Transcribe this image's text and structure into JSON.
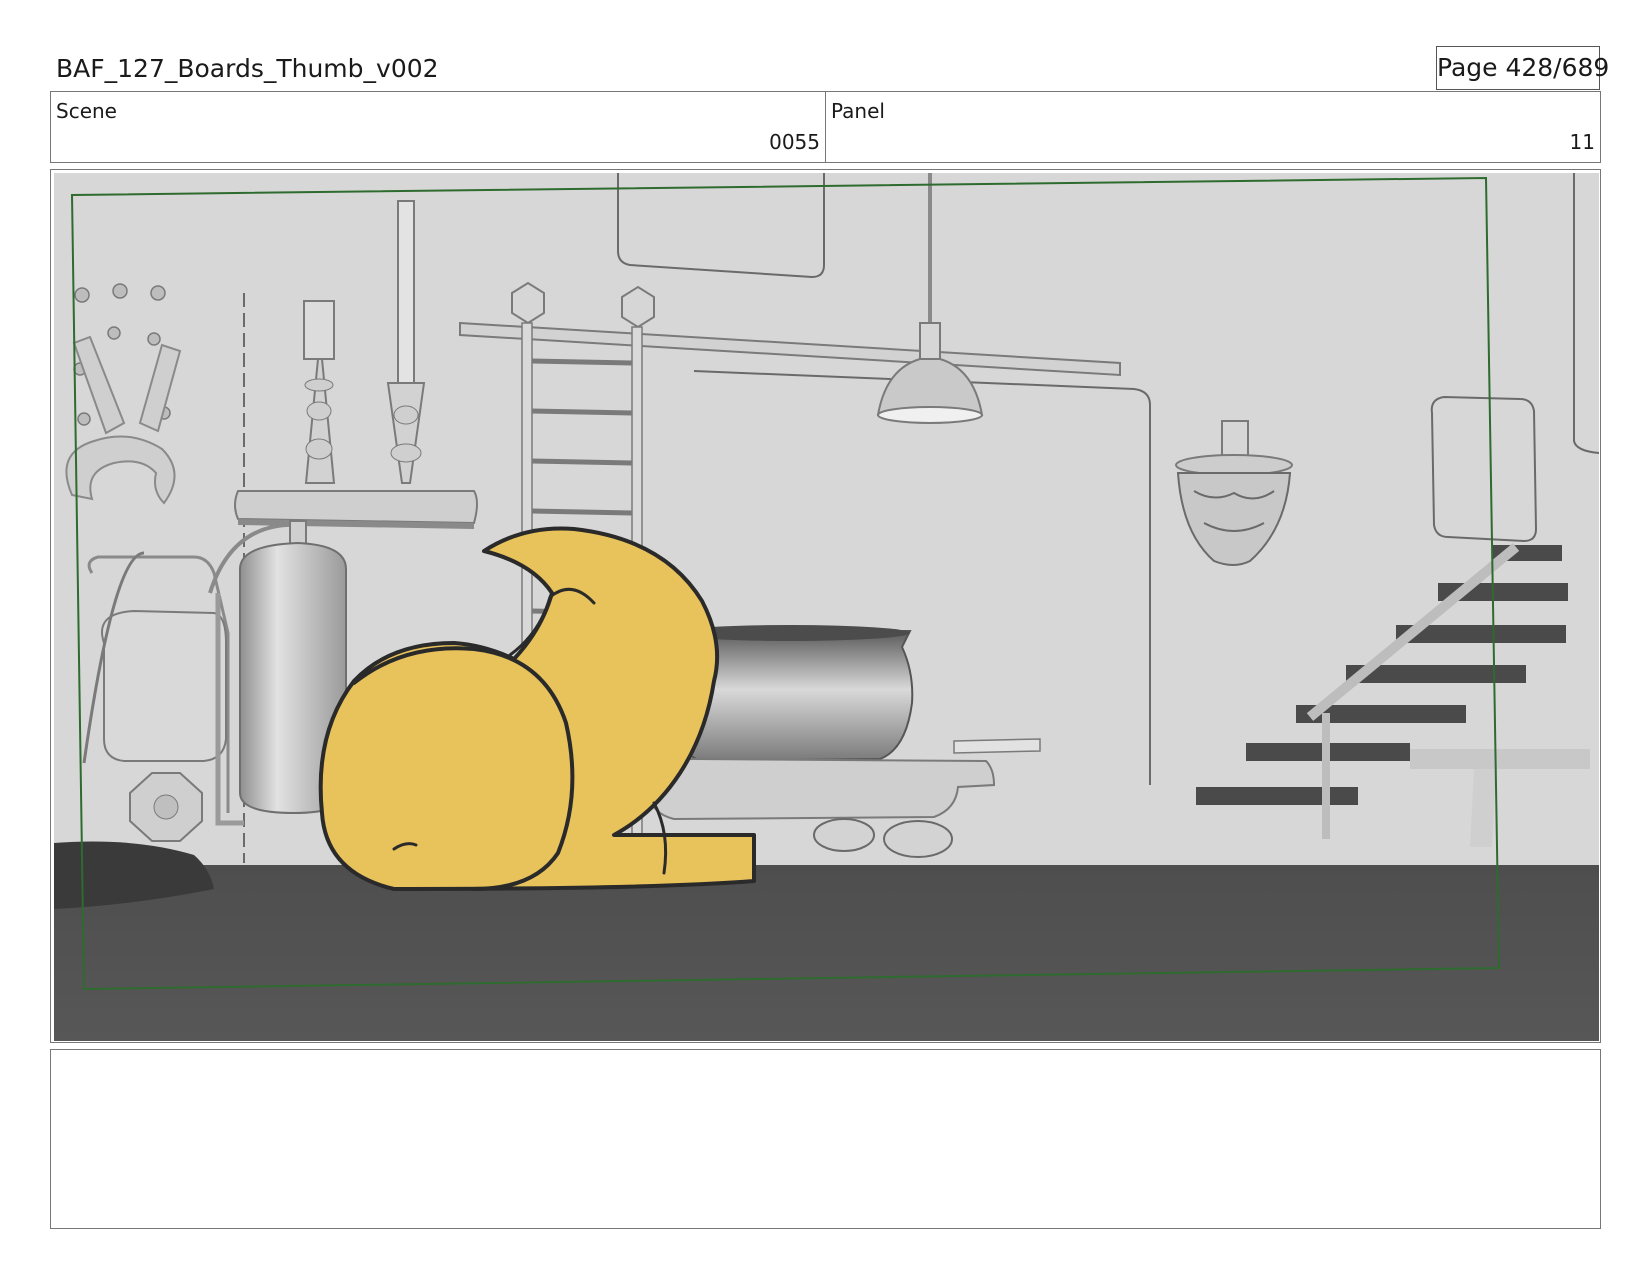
{
  "header": {
    "title": "BAF_127_Boards_Thumb_v002",
    "page": "Page 428/689"
  },
  "info": {
    "scene_label": "Scene",
    "scene_value": "0055",
    "panel_label": "Panel",
    "panel_value": "11"
  },
  "notes": {
    "text": ""
  },
  "colors": {
    "safe_frame": "#2e6b2e",
    "character": "#e8c25a",
    "floor": "#555555",
    "wall": "#d6d6d6"
  }
}
